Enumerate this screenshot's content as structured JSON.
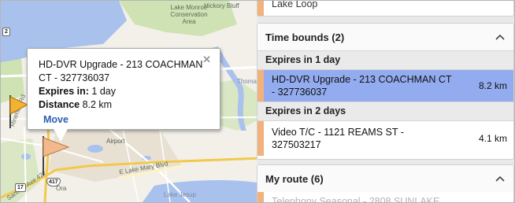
{
  "map": {
    "labels": {
      "conservation": "Lake Monroe\nConservation\nArea",
      "hickory": "Hickory Bluff",
      "airport": "Airport",
      "lake_mary_blvd": "E Lake Mary Blvd",
      "lake_jesup": "Lake Jesup",
      "thomas": "Thoma",
      "highway_417": "417",
      "highway_17": "17",
      "highway_2": "2",
      "rinehart": "Rinehart Rd",
      "county_427": "Sanford Ave 427",
      "oran": "Ora"
    },
    "colors": {
      "water": "#a9c2ed",
      "land": "#f2f0e9",
      "park": "#cfe2b3",
      "urban": "#e8e1d3",
      "highway": "#f2c94c"
    },
    "markers": [
      {
        "name": "flag-marker",
        "color": "#f4b233"
      },
      {
        "name": "flag-marker-selected",
        "color": "#f3b98c"
      }
    ]
  },
  "bubble": {
    "title": "HD-DVR Upgrade - 213 COACHMAN CT - 327736037",
    "expires_label": "Expires in:",
    "expires_value": " 1 day",
    "distance_label": "Distance",
    "distance_value": " 8.2 km",
    "move_label": "Move",
    "close_icon": "close-icon"
  },
  "panel": {
    "top_partial": {
      "label": "Lake Loop"
    },
    "time_bounds": {
      "title": "Time bounds (2)",
      "chevron": "chevron-up-icon",
      "groups": [
        {
          "label": "Expires in 1 day",
          "tasks": [
            {
              "name": "HD-DVR Upgrade - 213 COACHMAN CT - 327736037",
              "distance": "8.2 km",
              "selected": true
            }
          ]
        },
        {
          "label": "Expires in 2 days",
          "tasks": [
            {
              "name": "Video T/C - 1121 REAMS ST - 327503217",
              "distance": "4.1 km",
              "selected": false
            }
          ]
        }
      ]
    },
    "my_route": {
      "title": "My route (6)",
      "chevron": "chevron-up-icon",
      "first_item": "Telephony Seasonal - 2808 SUNLAKE"
    },
    "colors": {
      "selected": "#93acf0",
      "strip": "#f2b27c",
      "group_bg": "#eaeaea"
    }
  }
}
